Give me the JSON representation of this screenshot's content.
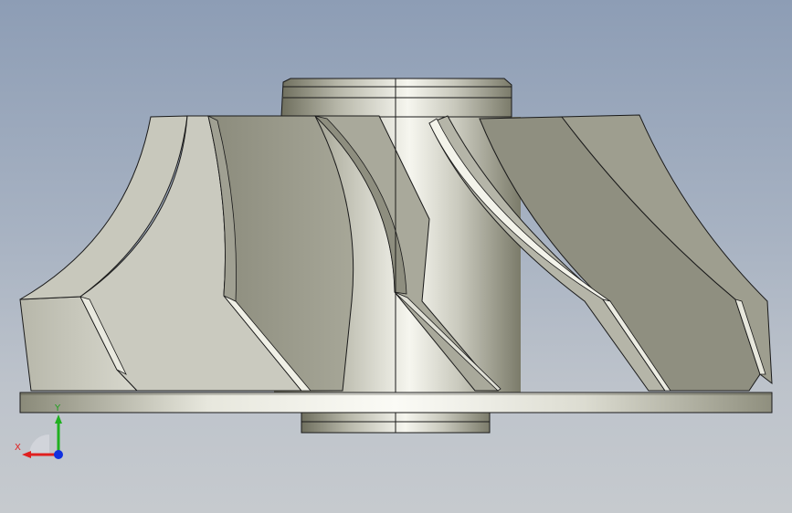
{
  "triad": {
    "x_label": "X",
    "y_label": "Y",
    "colors": {
      "x": "#e02020",
      "y": "#20b020",
      "z": "#1030e0"
    }
  },
  "model": {
    "part": "impeller",
    "blade_count_visible": 7,
    "colors": {
      "metal_light": "#f2f2ea",
      "metal_mid": "#c8c8bc",
      "metal_dark": "#7a7a68",
      "edge": "#1a1a1a"
    }
  }
}
